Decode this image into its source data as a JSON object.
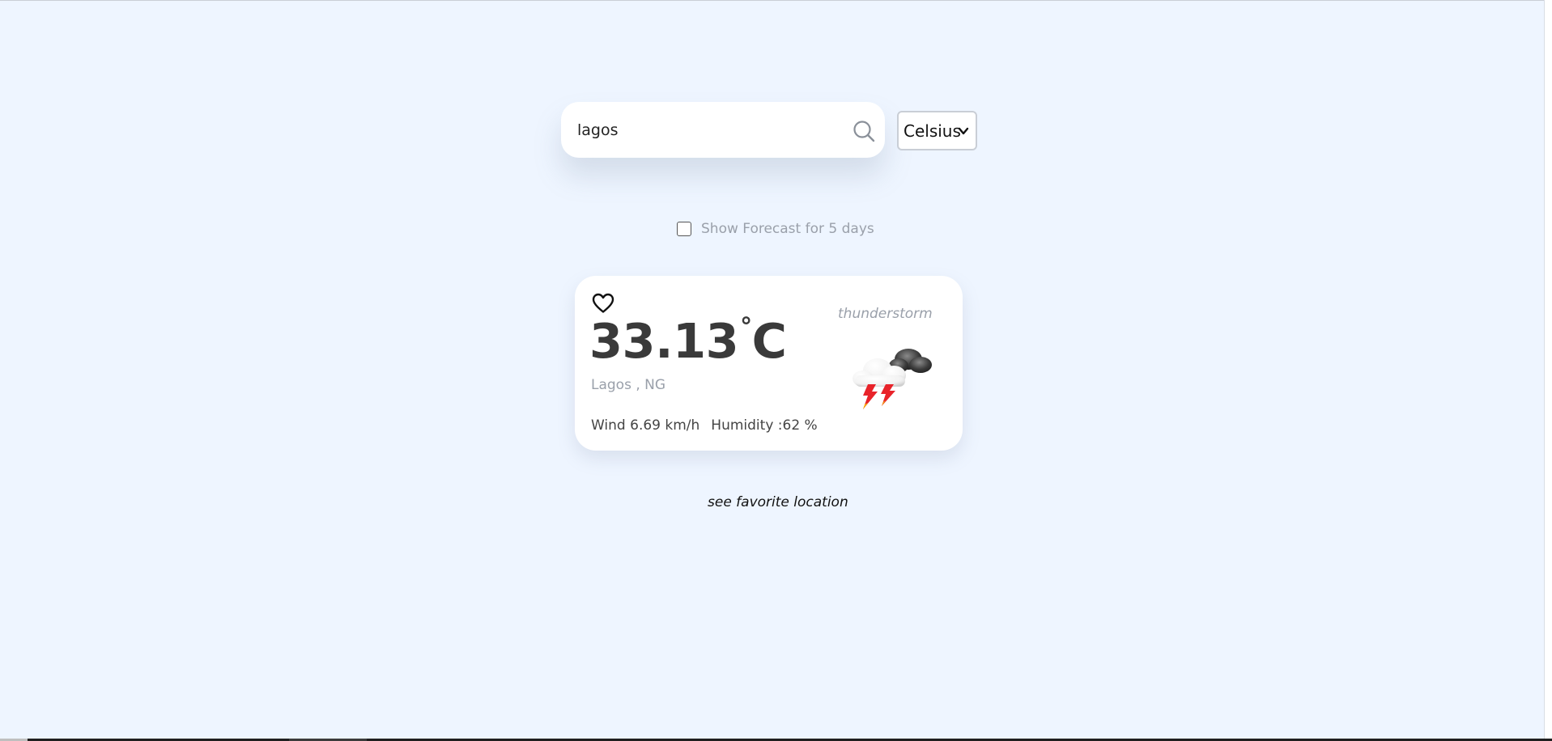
{
  "search": {
    "value": "lagos",
    "icon": "search-icon"
  },
  "unit_select": {
    "selected": "Celsius",
    "icon": "chevron-down-icon"
  },
  "forecast_toggle": {
    "checked": false,
    "label": "Show Forecast for 5 days"
  },
  "weather_card": {
    "favorite_icon": "heart-icon",
    "temperature": "33.13",
    "degree_symbol": "°",
    "unit": "C",
    "location": "Lagos , NG",
    "wind": "Wind 6.69 km/h",
    "humidity": "Humidity :62 %",
    "condition": "thunderstorm",
    "condition_icon": "thunderstorm-icon"
  },
  "favorites_link": "see favorite location",
  "colors": {
    "page_background": "#eef5ff",
    "card_background": "#ffffff",
    "muted_text": "#9aa0aa",
    "temperature_text": "#3a3a3a",
    "bolt_red": "#e8232a"
  }
}
